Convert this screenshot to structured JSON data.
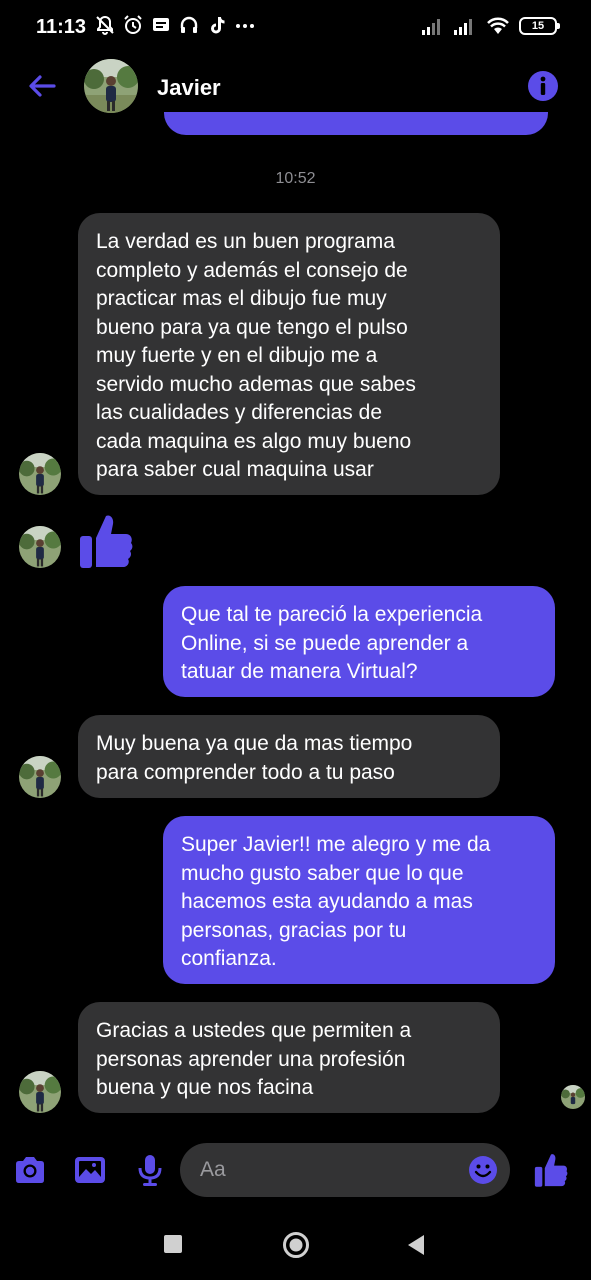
{
  "status_bar": {
    "time": "11:13",
    "battery": "15",
    "battery_level": 0.15
  },
  "header": {
    "contact_name": "Javier"
  },
  "chat": {
    "timestamp": "10:52",
    "messages": [
      {
        "direction": "in",
        "lines": [
          "La verdad es un buen programa",
          "completo y además el consejo de",
          "practicar mas el dibujo fue muy",
          "bueno para ya que tengo el pulso",
          "muy fuerte y en el dibujo me a",
          "servido mucho ademas que sabes",
          "las cualidades y diferencias de",
          "cada maquina es algo muy bueno",
          "para saber cual maquina usar"
        ]
      },
      {
        "direction": "in",
        "sticker": "thumbs-up"
      },
      {
        "direction": "out",
        "lines": [
          "Que tal te pareció la experiencia",
          "Online, si se puede aprender a",
          "tatuar de manera Virtual?"
        ]
      },
      {
        "direction": "in",
        "lines": [
          "Muy buena ya que da mas tiempo",
          "para comprender todo a tu paso"
        ]
      },
      {
        "direction": "out",
        "lines": [
          "Super Javier!! me alegro y me da",
          "mucho gusto saber que lo que",
          "hacemos esta ayudando a mas",
          "personas, gracias por tu",
          "confianza."
        ]
      },
      {
        "direction": "in",
        "lines": [
          "Gracias a ustedes que permiten a",
          "personas aprender una profesión",
          "buena y que nos facina"
        ]
      }
    ]
  },
  "composer": {
    "placeholder": "Aa"
  },
  "colors": {
    "accent": "#5b4ce8",
    "incoming_bubble": "#333334",
    "background": "#000000",
    "timestamp_text": "#8e8e93"
  },
  "icons": {
    "back": "arrow-left-icon",
    "info": "info-icon",
    "camera": "camera-icon",
    "gallery": "image-icon",
    "mic": "microphone-icon",
    "emoji": "smiley-icon",
    "like": "thumbs-up-icon"
  }
}
